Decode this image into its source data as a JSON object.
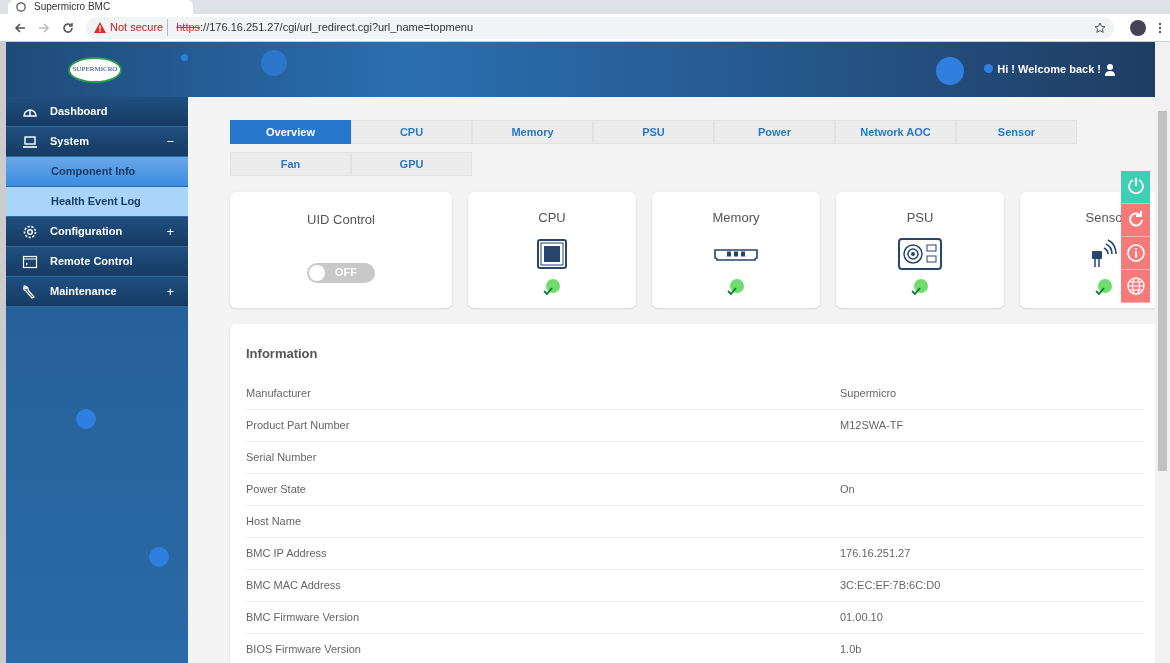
{
  "browser": {
    "tab_title": "Supermicro BMC",
    "security": "Not secure",
    "url_scheme": "https",
    "url_rest": "://176.16.251.27/cgi/url_redirect.cgi?url_name=topmenu"
  },
  "header": {
    "logo": "SUPERMICRO",
    "greeting": "Hi ! Welcome back !"
  },
  "sidebar": {
    "items": [
      {
        "label": "Dashboard"
      },
      {
        "label": "System",
        "toggle": "−",
        "children": [
          {
            "label": "Component Info",
            "selected": true
          },
          {
            "label": "Health Event Log",
            "selected": false
          }
        ]
      },
      {
        "label": "Configuration",
        "toggle": "+"
      },
      {
        "label": "Remote Control"
      },
      {
        "label": "Maintenance",
        "toggle": "+"
      }
    ]
  },
  "tabs": [
    {
      "label": "Overview",
      "selected": true
    },
    {
      "label": "CPU",
      "selected": false
    },
    {
      "label": "Memory",
      "selected": false
    },
    {
      "label": "PSU",
      "selected": false
    },
    {
      "label": "Power",
      "selected": false
    },
    {
      "label": "Network AOC",
      "selected": false
    },
    {
      "label": "Sensor",
      "selected": false
    },
    {
      "label": "Fan",
      "selected": false
    },
    {
      "label": "GPU",
      "selected": false
    }
  ],
  "uid_control": {
    "title": "UID Control",
    "toggle_label": "OFF",
    "on": false
  },
  "cards": [
    {
      "title": "CPU",
      "healthy": true
    },
    {
      "title": "Memory",
      "healthy": true
    },
    {
      "title": "PSU",
      "healthy": true
    },
    {
      "title": "Senso",
      "healthy": true
    }
  ],
  "information": {
    "title": "Information",
    "rows": [
      {
        "label": "Manufacturer",
        "value": "Supermicro"
      },
      {
        "label": "Product Part Number",
        "value": "M12SWA-TF"
      },
      {
        "label": "Serial Number"
      },
      {
        "label": "Power State",
        "value": "On"
      },
      {
        "label": "Host Name"
      },
      {
        "label": "BMC IP Address",
        "value": "176.16.251.27"
      },
      {
        "label": "BMC MAC Address",
        "value": "3C:EC:EF:7B:6C:D0"
      },
      {
        "label": "BMC Firmware Version",
        "value": "01.00.10"
      },
      {
        "label": "BIOS Firmware Version",
        "value": "1.0b"
      }
    ]
  },
  "quick_actions": [
    {
      "color": "#3fcfb5"
    },
    {
      "color": "#f77a7a"
    },
    {
      "color": "#f77a7a"
    },
    {
      "color": "#f77a7a"
    }
  ]
}
